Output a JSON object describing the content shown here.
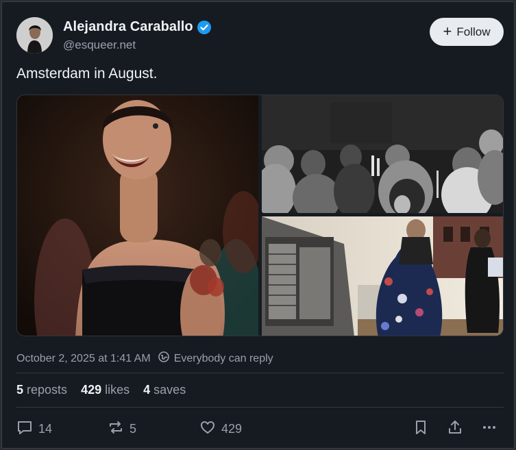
{
  "author": {
    "name": "Alejandra Caraballo",
    "handle": "@esqueer.net",
    "verified": true
  },
  "follow_label": "Follow",
  "post_text": "Amsterdam in August.",
  "timestamp": "October 2, 2025 at 1:41 AM",
  "reply_setting": "Everybody can reply",
  "stats": {
    "reposts": {
      "count": "5",
      "label": "reposts"
    },
    "likes": {
      "count": "429",
      "label": "likes"
    },
    "saves": {
      "count": "4",
      "label": "saves"
    }
  },
  "actions": {
    "replies": "14",
    "reposts": "5",
    "likes": "429"
  },
  "colors": {
    "background": "#161b22",
    "verified_badge": "#1d9bf0",
    "follow_button": "#e8ebef"
  },
  "icons": [
    "verified-icon",
    "plus-icon",
    "globe-icon",
    "reply-icon",
    "repost-icon",
    "like-icon",
    "bookmark-icon",
    "share-icon",
    "more-icon"
  ]
}
